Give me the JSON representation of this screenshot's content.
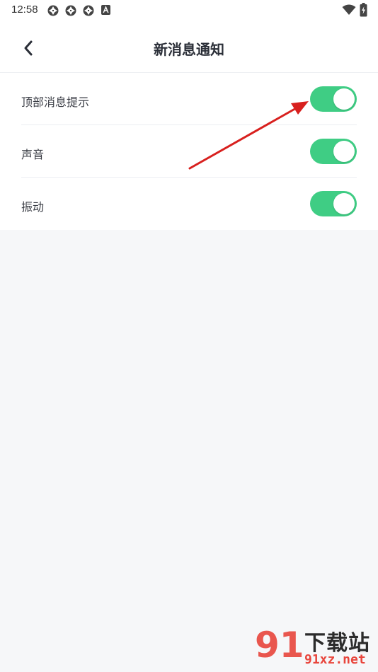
{
  "status_bar": {
    "time": "12:58",
    "left_icons": [
      "aperture-icon",
      "aperture-icon",
      "aperture-icon",
      "a-notification-icon"
    ],
    "right_icons": [
      "wifi-icon",
      "battery-charging-icon"
    ]
  },
  "header": {
    "title": "新消息通知",
    "back_icon": "chevron-left-icon"
  },
  "settings": [
    {
      "label": "顶部消息提示",
      "enabled": true
    },
    {
      "label": "声音",
      "enabled": true
    },
    {
      "label": "振动",
      "enabled": true
    }
  ],
  "colors": {
    "toggle_on": "#3fcd84",
    "background": "#f6f7f9",
    "annotation_arrow": "#d8201e"
  },
  "watermark": {
    "logo": "91",
    "title": "下载站",
    "url": "91xz.net"
  }
}
